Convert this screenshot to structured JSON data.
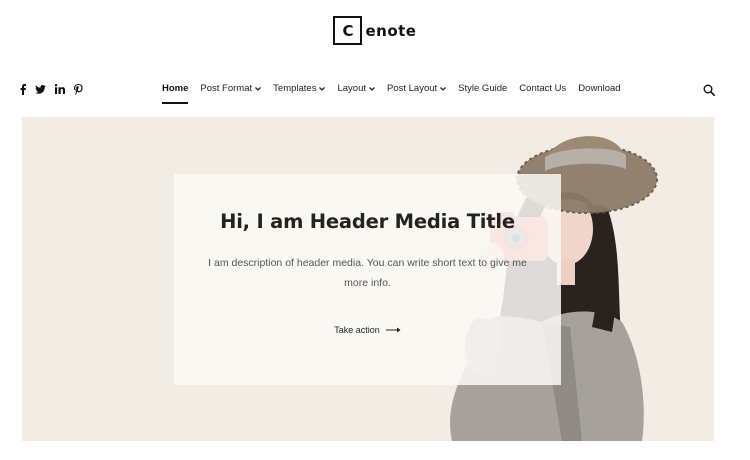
{
  "logo": {
    "letter": "C",
    "rest": "enote"
  },
  "social": [
    {
      "icon": "facebook-icon"
    },
    {
      "icon": "twitter-icon"
    },
    {
      "icon": "linkedin-icon"
    },
    {
      "icon": "pinterest-icon"
    }
  ],
  "nav": {
    "items": [
      {
        "label": "Home",
        "active": true,
        "dropdown": false
      },
      {
        "label": "Post Format",
        "active": false,
        "dropdown": true
      },
      {
        "label": "Templates",
        "active": false,
        "dropdown": true
      },
      {
        "label": "Layout",
        "active": false,
        "dropdown": true
      },
      {
        "label": "Post Layout",
        "active": false,
        "dropdown": true
      },
      {
        "label": "Style Guide",
        "active": false,
        "dropdown": false
      },
      {
        "label": "Contact Us",
        "active": false,
        "dropdown": false
      },
      {
        "label": "Download",
        "active": false,
        "dropdown": false
      }
    ],
    "search_icon": "search-icon"
  },
  "hero": {
    "title": "Hi, I am Header Media Title",
    "description": "I am description of header media. You can write short text to give me more info.",
    "cta_label": "Take action",
    "cta_icon": "arrow-right-icon",
    "background_color": "#f1ece4"
  }
}
